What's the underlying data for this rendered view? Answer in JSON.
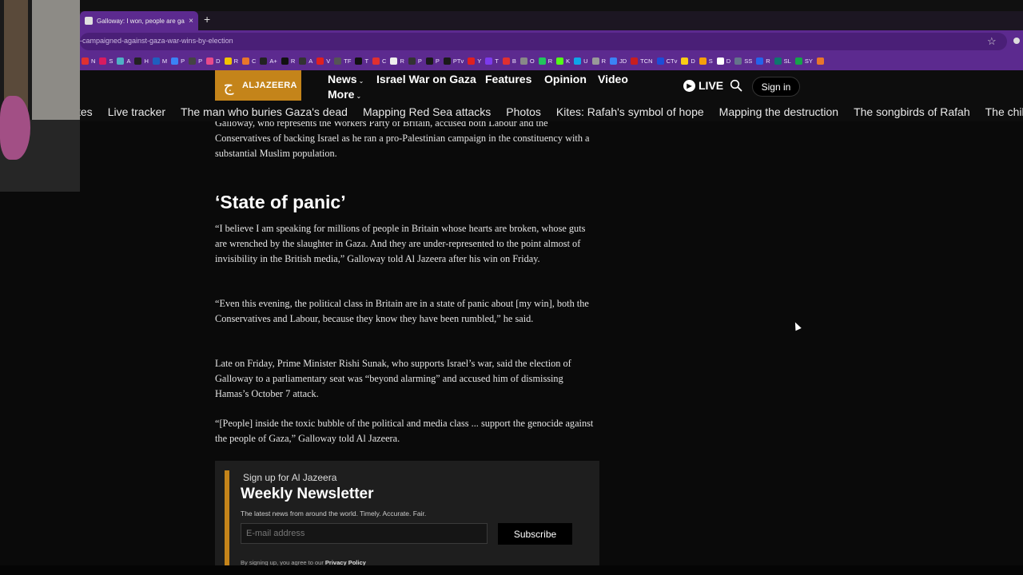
{
  "browser": {
    "tab_title": "Galloway: I won, people are ga...",
    "tab_close": "×",
    "new_tab": "+",
    "url": "-campaigned-against-gaza-war-wins-by-election",
    "star": "☆",
    "bookmarks": [
      {
        "label": "N",
        "color": "#e03030"
      },
      {
        "label": "S",
        "color": "#d81b60"
      },
      {
        "label": "A",
        "color": "#4fb0c6"
      },
      {
        "label": "H",
        "color": "#222222"
      },
      {
        "label": "M",
        "color": "#1f5fbf"
      },
      {
        "label": "P",
        "color": "#3b82f6"
      },
      {
        "label": "P",
        "color": "#444444"
      },
      {
        "label": "D",
        "color": "#e84a8a"
      },
      {
        "label": "R",
        "color": "#f2c300"
      },
      {
        "label": "C",
        "color": "#e8762b"
      },
      {
        "label": "A+",
        "color": "#222222"
      },
      {
        "label": "R",
        "color": "#111111"
      },
      {
        "label": "A",
        "color": "#333333"
      },
      {
        "label": "V",
        "color": "#e02020"
      },
      {
        "label": "TF",
        "color": "#555555"
      },
      {
        "label": "T",
        "color": "#111111"
      },
      {
        "label": "C",
        "color": "#e03030"
      },
      {
        "label": "R",
        "color": "#eeeeee"
      },
      {
        "label": "P",
        "color": "#333333"
      },
      {
        "label": "P",
        "color": "#1a1a1a"
      },
      {
        "label": "PTv",
        "color": "#1a1a1a"
      },
      {
        "label": "Y",
        "color": "#e02020"
      },
      {
        "label": "T",
        "color": "#7c3aed"
      },
      {
        "label": "B",
        "color": "#e03030"
      },
      {
        "label": "O",
        "color": "#888888"
      },
      {
        "label": "R",
        "color": "#22c55e"
      },
      {
        "label": "K",
        "color": "#53fc18"
      },
      {
        "label": "U",
        "color": "#0ea5e9"
      },
      {
        "label": "R",
        "color": "#999999"
      },
      {
        "label": "JD",
        "color": "#3b82f6"
      },
      {
        "label": "TCN",
        "color": "#c81e1e"
      },
      {
        "label": "CTv",
        "color": "#1d4ed8"
      },
      {
        "label": "D",
        "color": "#facc15"
      },
      {
        "label": "S",
        "color": "#f59e0b"
      },
      {
        "label": "D",
        "color": "#ffffff"
      },
      {
        "label": "SS",
        "color": "#64748b"
      },
      {
        "label": "R",
        "color": "#2563eb"
      },
      {
        "label": "SL",
        "color": "#0f766e"
      },
      {
        "label": "SY",
        "color": "#16a34a"
      },
      {
        "label": "",
        "color": "#e8762b"
      }
    ]
  },
  "site": {
    "logo_mark": "ج",
    "logo_text": "ALJAZEERA",
    "nav": {
      "news": "News",
      "israel_war": "Israel War on Gaza",
      "features": "Features",
      "opinion": "Opinion",
      "video": "Video",
      "more": "More",
      "chevron": "⌄"
    },
    "live": "LIVE",
    "sign_in": "Sign in",
    "subnav": [
      "tes",
      "Live tracker",
      "The man who buries Gaza's dead",
      "Mapping Red Sea attacks",
      "Photos",
      "Kites: Rafah's symbol of hope",
      "Mapping the destruction",
      "The songbirds of Rafah",
      "The childre"
    ]
  },
  "article": {
    "p0": "Galloway, who represents the Workers Party of Britain, accused both Labour and the Conservatives of backing Israel as he ran a pro-Palestinian campaign in the constituency with a substantial Muslim population.",
    "heading": "‘State of panic’",
    "p1": "“I believe I am speaking for millions of people in Britain whose hearts are broken, whose guts are wrenched by the slaughter in Gaza. And they are under-represented to the point almost of invisibility in the British media,” Galloway told Al Jazeera after his win on Friday.",
    "p2": "“Even this evening, the political class in Britain are in a state of panic about [my win], both the Conservatives and Labour, because they know they have been rumbled,” he said.",
    "p3": "Late on Friday, Prime Minister Rishi Sunak, who supports Israel’s war, said the election of Galloway to a parliamentary seat was “beyond alarming” and accused him of dismissing Hamas’s October 7 attack.",
    "p4": "“[People] inside the toxic bubble of the political and media class ... support the genocide against the people of Gaza,” Galloway told Al Jazeera."
  },
  "newsletter": {
    "kicker": "Sign up for Al Jazeera",
    "title": "Weekly Newsletter",
    "description": "The latest news from around the world. Timely. Accurate. Fair.",
    "email_placeholder": "E-mail address",
    "subscribe": "Subscribe",
    "legal_prefix": "By signing up, you agree to our",
    "legal_link": "Privacy Policy"
  },
  "colors": {
    "brand": "#c4841a",
    "browser_accent": "#5c2a8f"
  }
}
